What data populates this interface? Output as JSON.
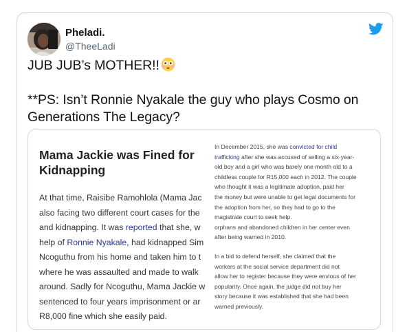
{
  "tweet": {
    "display_name": "Pheladi.",
    "handle": "@TheeLadi",
    "line1": "JUB JUB’s MOTHER!!",
    "emoji": "flushed-face-emoji",
    "line2": "**PS: Isn’t Ronnie Nyakale the guy who plays Cosmo on",
    "line3": "Generations The Legacy?"
  },
  "media": {
    "heading_line1": "Mama Jackie was Fined for",
    "heading_line2": "Kidnapping",
    "left_lines": [
      {
        "pre": "At that time, Raisibe Ramohlola (Mama Jac",
        "link": "",
        "post": ""
      },
      {
        "pre": "also facing two different court cases for the",
        "link": "",
        "post": ""
      },
      {
        "pre": "and kidnapping. It was ",
        "link": "reported",
        "post": " that she, w"
      },
      {
        "pre": "help of ",
        "link": "Ronnie Nyakale",
        "post": ", had kidnapped Sim"
      },
      {
        "pre": "Ncoguthu from his home and taken him to t",
        "link": "",
        "post": ""
      },
      {
        "pre": "where he was assaulted and made to walk",
        "link": "",
        "post": ""
      },
      {
        "pre": "around. Sadly for Ncoguthu, Mama Jackie w",
        "link": "",
        "post": ""
      },
      {
        "pre": "sentenced to four years imprisonment or ar",
        "link": "",
        "post": ""
      },
      {
        "pre": "R8,000 fine which she easily paid.",
        "link": "",
        "post": ""
      }
    ],
    "right_para1": [
      {
        "pre": "In December 2015, she was ",
        "link": "convicted for child",
        "post": ""
      },
      {
        "pre": "",
        "link": "trafficking",
        "post": " after she was accused of selling a six-year-"
      },
      {
        "pre": "old boy and a girl who was barely one month old to a",
        "link": "",
        "post": ""
      },
      {
        "pre": "childless couple for R15,000 each in 2012. The couple",
        "link": "",
        "post": ""
      },
      {
        "pre": "who thought it was a legitimate adoption, paid her",
        "link": "",
        "post": ""
      },
      {
        "pre": "the money but were unable to get legal documents for",
        "link": "",
        "post": ""
      },
      {
        "pre": "the adoption from her, so they had to go to the",
        "link": "",
        "post": ""
      },
      {
        "pre": "magistrate court to seek help.",
        "link": "",
        "post": ""
      },
      {
        "pre": "orphans and abandoned children in her center even",
        "link": "",
        "post": ""
      },
      {
        "pre": "after being warned in 2010.",
        "link": "",
        "post": ""
      }
    ],
    "right_para2": [
      "In a bid to defend herself, she claimed that the",
      "workers at the social service department did not",
      "allow her to register because they were envious of her",
      "popularity. Once again, the judge did not buy her",
      "story because it was established that she had been",
      "warned previously."
    ]
  },
  "colors": {
    "twitter_blue": "#1d9bf0",
    "link_color": "#2c3b8f",
    "border": "#cfd9de",
    "secondary_text": "#536471"
  }
}
